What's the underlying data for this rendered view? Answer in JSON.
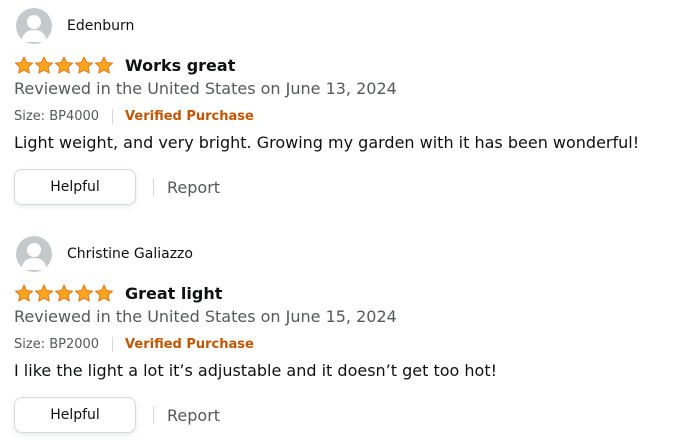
{
  "colors": {
    "star_fill": "#ffa41c",
    "star_outline": "#de7921",
    "verified": "#c45500",
    "secondary_text": "#565959",
    "avatar_bg": "#c4c9cb"
  },
  "reviews": [
    {
      "profile_name": "Edenburn",
      "rating": 5,
      "rating_max": 5,
      "title": "Works great",
      "date_line": "Reviewed in the United States on June 13, 2024",
      "size": "Size: BP4000",
      "verified_label": "Verified Purchase",
      "body": "Light weight, and very bright. Growing my garden with it has been wonderful!",
      "helpful_label": "Helpful",
      "report_label": "Report",
      "avatar_icon": "default-avatar-icon"
    },
    {
      "profile_name": "Christine Galiazzo",
      "rating": 5,
      "rating_max": 5,
      "title": "Great light",
      "date_line": "Reviewed in the United States on June 15, 2024",
      "size": "Size: BP2000",
      "verified_label": "Verified Purchase",
      "body": "I like the light a lot it’s adjustable and it doesn’t get too hot!",
      "helpful_label": "Helpful",
      "report_label": "Report",
      "avatar_icon": "default-avatar-icon"
    }
  ]
}
